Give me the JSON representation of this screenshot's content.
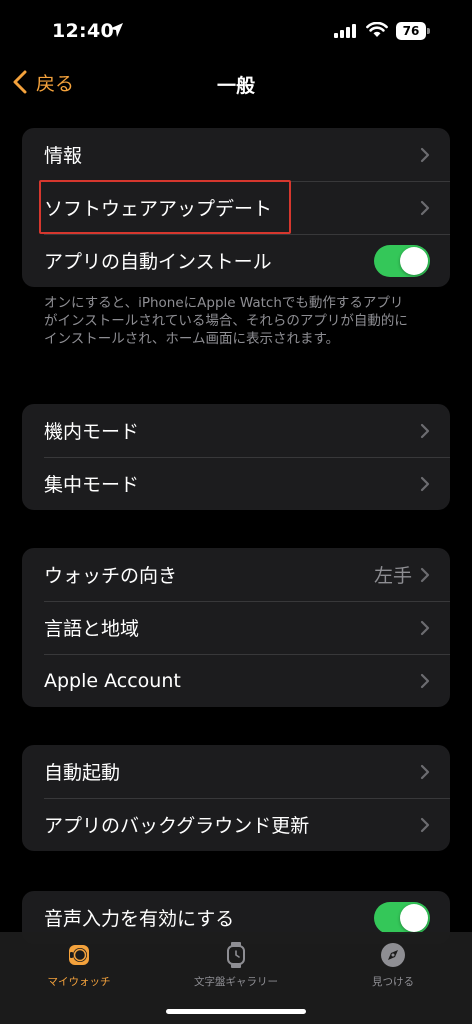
{
  "status_bar": {
    "time": "12:40",
    "battery": "76"
  },
  "nav": {
    "back_label": "戻る",
    "title": "一般"
  },
  "group1": {
    "items": [
      {
        "label": "情報"
      },
      {
        "label": "ソフトウェアアップデート"
      },
      {
        "label": "アプリの自動インストール",
        "toggle": true
      }
    ],
    "footnote": "オンにすると、iPhoneにApple Watchでも動作するアプリがインストールされている場合、それらのアプリが自動的にインストールされ、ホーム画面に表示されます。"
  },
  "group2": {
    "items": [
      {
        "label": "機内モード"
      },
      {
        "label": "集中モード"
      }
    ]
  },
  "group3": {
    "items": [
      {
        "label": "ウォッチの向き",
        "value": "左手"
      },
      {
        "label": "言語と地域"
      },
      {
        "label": "Apple Account"
      }
    ]
  },
  "group4": {
    "items": [
      {
        "label": "自動起動"
      },
      {
        "label": "アプリのバックグラウンド更新"
      }
    ]
  },
  "group5": {
    "items": [
      {
        "label": "音声入力を有効にする",
        "toggle": true
      }
    ]
  },
  "tab_bar": {
    "tabs": [
      {
        "label": "マイウォッチ",
        "icon": "watch-face-icon",
        "active": true
      },
      {
        "label": "文字盤ギャラリー",
        "icon": "watch-icon",
        "active": false
      },
      {
        "label": "見つける",
        "icon": "compass-icon",
        "active": false
      }
    ]
  },
  "colors": {
    "accent": "#f4a23c",
    "toggle_on": "#34c759",
    "highlight": "#d6372e",
    "cell_bg": "#1c1c1e"
  }
}
